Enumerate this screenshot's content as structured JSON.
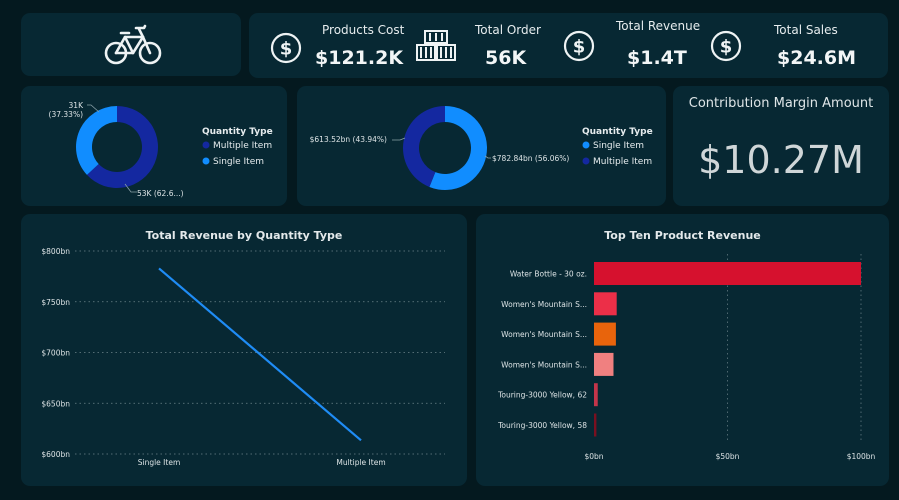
{
  "kpis": [
    {
      "title": "Products Cost",
      "value": "$121.2K",
      "icon": "dollar-circle-icon"
    },
    {
      "title": "Total Order",
      "value": "56K",
      "icon": "containers-icon"
    },
    {
      "title": "Total Revenue",
      "value": "$1.4T",
      "icon": "dollar-circle-icon"
    },
    {
      "title": "Total Sales",
      "value": "$24.6M",
      "icon": "dollar-circle-icon"
    }
  ],
  "logo_icon": "bicycle-icon",
  "contribution": {
    "title": "Contribution Margin Amount",
    "value": "$10.27M"
  },
  "colors": {
    "dark_blue": "#1428a0",
    "light_blue": "#118dff",
    "line": "#1f8cf5"
  },
  "chart_data": [
    {
      "type": "pie",
      "subtype": "donut",
      "legend_title": "Quantity Type",
      "legend_position": "right",
      "slices": [
        {
          "name": "Multiple Item",
          "value": 53,
          "label": "53K (62.6...)",
          "color": "#1428a0"
        },
        {
          "name": "Single Item",
          "value": 31,
          "label": "31K (37.33%)",
          "color": "#118dff"
        }
      ]
    },
    {
      "type": "pie",
      "subtype": "donut",
      "legend_title": "Quantity Type",
      "legend_position": "right",
      "slices": [
        {
          "name": "Single Item",
          "value": 782.84,
          "label": "$782.84bn (56.06%)",
          "color": "#118dff"
        },
        {
          "name": "Multiple Item",
          "value": 613.52,
          "label": "$613.52bn (43.94%)",
          "color": "#1428a0"
        }
      ]
    },
    {
      "type": "line",
      "title": "Total Revenue by Quantity Type",
      "categories": [
        "Single Item",
        "Multiple Item"
      ],
      "values": [
        782.84,
        613.52
      ],
      "ylim": [
        600,
        800
      ],
      "yticks": [
        600,
        650,
        700,
        750,
        800
      ],
      "ytick_labels": [
        "$600bn",
        "$650bn",
        "$700bn",
        "$750bn",
        "$800bn"
      ],
      "grid": true
    },
    {
      "type": "bar",
      "orientation": "horizontal",
      "title": "Top Ten Product Revenue",
      "categories": [
        "Water Bottle - 30 oz.",
        "Women's Mountain S...",
        "Women's Mountain S...",
        "Women's Mountain S...",
        "Touring-3000 Yellow, 62",
        "Touring-3000 Yellow, 58"
      ],
      "values": [
        100,
        8.5,
        8.2,
        7.3,
        1.4,
        0.9
      ],
      "colors": [
        "#d6112e",
        "#ec2f48",
        "#e8640c",
        "#f08080",
        "#c4354a",
        "#7a1020"
      ],
      "xlim": [
        0,
        100
      ],
      "xticks": [
        0,
        50,
        100
      ],
      "xtick_labels": [
        "$0bn",
        "$50bn",
        "$100bn"
      ],
      "grid": true
    }
  ]
}
